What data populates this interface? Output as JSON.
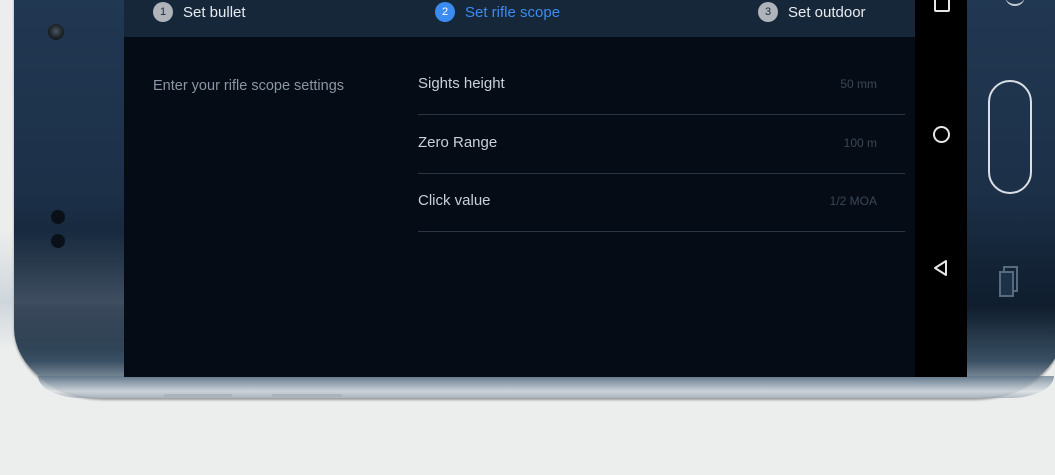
{
  "stepper": {
    "steps": [
      {
        "num": "1",
        "label": "Set bullet",
        "active": false
      },
      {
        "num": "2",
        "label": "Set rifle scope",
        "active": true
      },
      {
        "num": "3",
        "label": "Set outdoor",
        "active": false
      }
    ]
  },
  "content": {
    "intro": "Enter your rifle scope settings",
    "fields": [
      {
        "label": "Sights height",
        "value": "50 mm"
      },
      {
        "label": "Zero Range",
        "value": "100 m"
      },
      {
        "label": "Click value",
        "value": "1/2 MOA"
      }
    ]
  },
  "navbar": {
    "icons": [
      "recent-apps-icon",
      "home-icon",
      "back-icon"
    ]
  },
  "colors": {
    "accent": "#3a8cf0",
    "screen_bg": "#050c16",
    "stepper_bg": "#17273a"
  }
}
